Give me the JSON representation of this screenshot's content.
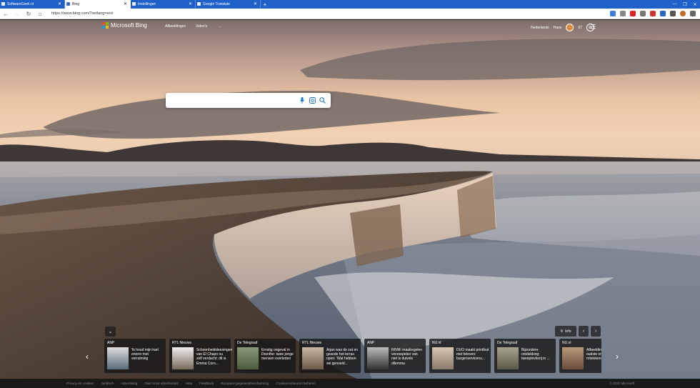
{
  "browser": {
    "tabs": [
      {
        "label": "SoftwareGeek.nl"
      },
      {
        "label": "Bing"
      },
      {
        "label": "Instellingen"
      },
      {
        "label": "Google Translate"
      }
    ],
    "url": "https://www.bing.com/?setlang=en#"
  },
  "header": {
    "brand": "Microsoft Bing",
    "nav": {
      "afbeeldingen": "Afbeeldingen",
      "videos": "Video's",
      "more": "..."
    },
    "language": "Nederlands",
    "user": "Hans",
    "points": "67"
  },
  "search": {
    "value": ""
  },
  "info_label": "Info",
  "news": [
    {
      "source": "ANP",
      "title": "'Ik houd mijn hart enorm met verruiming"
    },
    {
      "source": "RTL Nieuws",
      "title": "Schoonheidsleesingen van El Chapo nu zelf verdacht: dit is Emma Coro..."
    },
    {
      "source": "De Telegraaf",
      "title": "Ernstig ongeval in Drenthe: twee jonge mensen overleden"
    },
    {
      "source": "RTL Nieuws",
      "title": "Arjan was de zat en gzaode het terras open: 'Wat hebben we genoeid..."
    },
    {
      "source": "ANP",
      "title": "RIVM: maatregelen versoepelen van niet is duivels dilemma"
    },
    {
      "source": "NU.nl",
      "title": "DUO maakt printfout met brieven: burgerservicenu..."
    },
    {
      "source": "De Telegraaf",
      "title": "Bijzondere ontdekking: tweeplevkerij in ..."
    },
    {
      "source": "NU.nl",
      "title": "Afbeelding kangeroe oudste ont rotstekenin..."
    }
  ],
  "footer": {
    "links": [
      "Privacy en cookies",
      "Juridisch",
      "Advertising",
      "Over onze advertenties",
      "Help",
      "Feedback",
      "Europese gegevensbescherming",
      "Cookievoorkeuren beheren"
    ],
    "copyright": "© 2021 Microsoft"
  },
  "colors": {
    "tabbar": "#1f61c9",
    "search_icons": "#1a73c8"
  }
}
